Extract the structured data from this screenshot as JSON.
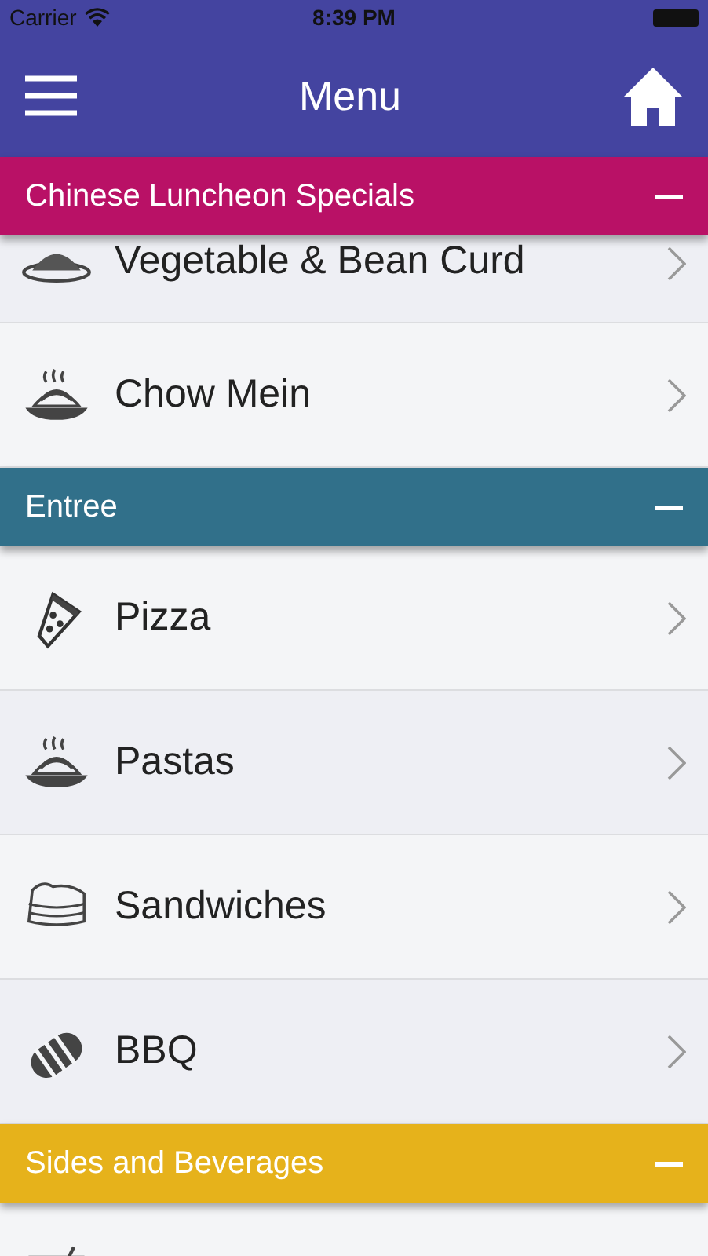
{
  "status_bar": {
    "carrier": "Carrier",
    "time": "8:39 PM"
  },
  "nav_bar": {
    "title": "Menu"
  },
  "sections": [
    {
      "title": "Chinese Luncheon Specials",
      "color": "#b91166",
      "expanded": true,
      "items": [
        {
          "label": "Vegetable & Bean Curd",
          "kind": "plate"
        },
        {
          "label": "Chow Mein",
          "kind": "noodles"
        }
      ]
    },
    {
      "title": "Entree",
      "color": "#31708a",
      "expanded": true,
      "items": [
        {
          "label": "Pizza",
          "kind": "pizza"
        },
        {
          "label": "Pastas",
          "kind": "noodles"
        },
        {
          "label": "Sandwiches",
          "kind": "sandwich"
        },
        {
          "label": "BBQ",
          "kind": "bbq"
        }
      ]
    },
    {
      "title": "Sides and Beverages",
      "color": "#e6b21b",
      "expanded": true,
      "items": [
        {
          "kind": "cocktail"
        }
      ]
    }
  ]
}
